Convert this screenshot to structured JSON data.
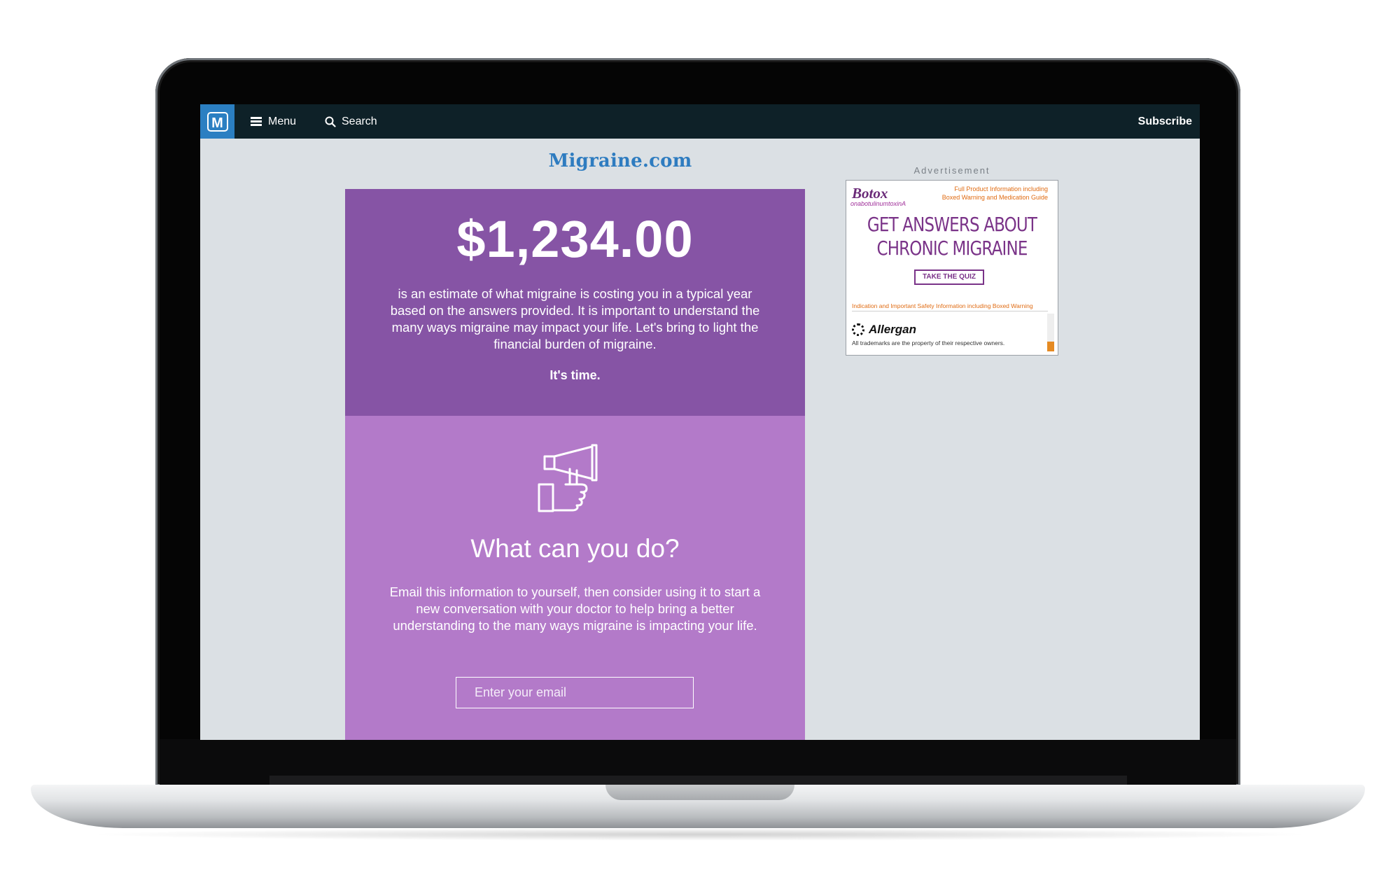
{
  "nav": {
    "logo_letter": "M",
    "menu_label": "Menu",
    "search_label": "Search",
    "subscribe_label": "Subscribe"
  },
  "site": {
    "name": "Migraine.com"
  },
  "result": {
    "amount": "$1,234.00",
    "description": "is an estimate of what migraine is costing you in a typical year based on the answers provided. It is important to understand the many ways migraine may impact your life. Let's bring to light the financial burden of migraine.",
    "tagline": "It's time."
  },
  "action": {
    "icon": "megaphone-icon",
    "heading": "What can you do?",
    "body": "Email this information to yourself, then consider using it to start a new conversation with your doctor to help bring a better understanding to the many ways migraine is impacting your life.",
    "email_placeholder": "Enter your email"
  },
  "ad": {
    "label": "Advertisement",
    "brand": "Botox",
    "brand_sub": "onabotulinumtoxinA",
    "fpi_line1": "Full Product Information including",
    "fpi_line2": "Boxed Warning and Medication Guide",
    "headline_line1": "GET ANSWERS ABOUT",
    "headline_line2": "CHRONIC MIGRAINE",
    "cta": "TAKE THE QUIZ",
    "isi": "Indication and Important Safety Information including Boxed Warning",
    "company": "Allergan",
    "trademarks": "All trademarks are the property of their respective owners."
  },
  "colors": {
    "nav_bg": "#0e2128",
    "brand_blue": "#2b7fc2",
    "card_dark_purple": "#8654a5",
    "card_light_purple": "#b37ac9",
    "page_bg": "#dbe0e4"
  }
}
